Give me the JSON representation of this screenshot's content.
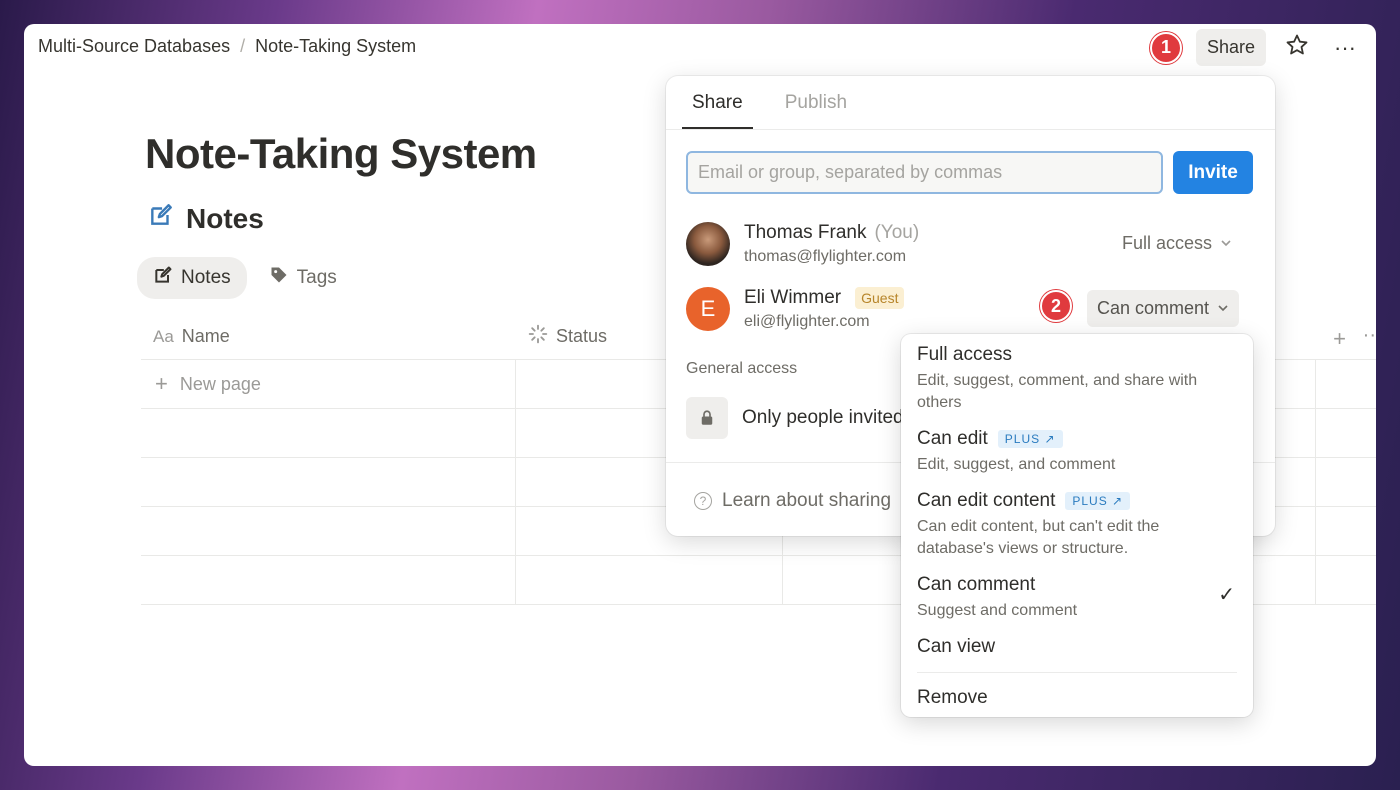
{
  "breadcrumb": {
    "parent": "Multi-Source Databases",
    "separator": "/",
    "current": "Note-Taking System"
  },
  "topbar": {
    "step1": "1",
    "share_label": "Share",
    "star_icon": "★",
    "more_icon": "···"
  },
  "page": {
    "title": "Note-Taking System",
    "db_title": "Notes"
  },
  "views": [
    {
      "label": "Notes"
    },
    {
      "label": "Tags"
    }
  ],
  "table": {
    "columns": [
      {
        "label": "Name",
        "icon": "Aa"
      },
      {
        "label": "Status"
      }
    ],
    "new_page": "New page"
  },
  "share_popup": {
    "tabs": [
      "Share",
      "Publish"
    ],
    "email_placeholder": "Email or group, separated by commas",
    "invite_label": "Invite",
    "people": [
      {
        "name": "Thomas Frank",
        "you": "(You)",
        "email": "thomas@flylighter.com",
        "access": "Full access"
      },
      {
        "name": "Eli Wimmer",
        "initial": "E",
        "badge": "Guest",
        "email": "eli@flylighter.com",
        "access": "Can comment"
      }
    ],
    "step2": "2",
    "general_access_label": "General access",
    "general_access_value": "Only people invited",
    "learn_label": "Learn about sharing"
  },
  "menu": {
    "items": [
      {
        "label": "Full access",
        "desc": "Edit, suggest, comment, and share with others"
      },
      {
        "label": "Can edit",
        "tag": "PLUS ↗",
        "desc": "Edit, suggest, and comment"
      },
      {
        "label": "Can edit content",
        "tag": "PLUS ↗",
        "desc": "Can edit content, but can't edit the database's views or structure."
      },
      {
        "label": "Can comment",
        "desc": "Suggest and comment",
        "selected": true
      },
      {
        "label": "Can view"
      }
    ],
    "remove_label": "Remove"
  },
  "colors": {
    "accent": "#2383e2",
    "badge": "#e03a3e",
    "guest_bg": "#fbefd2",
    "avatar_letter": "#e8632b"
  }
}
